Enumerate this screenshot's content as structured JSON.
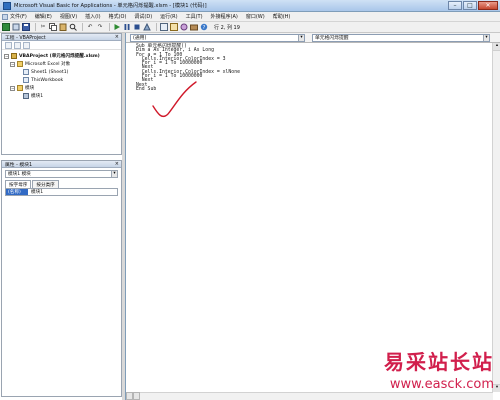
{
  "window": {
    "title": "Microsoft Visual Basic for Applications - 单元格闪烁提醒.xlsm - [模块1 (代码)]",
    "minimize": "–",
    "maximize": "□",
    "close": "✕"
  },
  "menus": [
    "文件(F)",
    "编辑(E)",
    "视图(V)",
    "插入(I)",
    "格式(O)",
    "调试(D)",
    "运行(R)",
    "工具(T)",
    "外接程序(A)",
    "窗口(W)",
    "帮助(H)"
  ],
  "toolbar": {
    "position": "行 2, 列 19"
  },
  "project": {
    "title": "工程 - VBAProject",
    "close": "×",
    "root": "VBAProject (单元格闪烁提醒.xlsm)",
    "excel_objects": "Microsoft Excel 对象",
    "sheet1": "Sheet1 (Sheet1)",
    "thisworkbook": "ThisWorkbook",
    "modules_folder": "模块",
    "module1": "模块1"
  },
  "properties": {
    "title": "属性 - 模块1",
    "close": "×",
    "selector": "模块1 模块",
    "tab_alpha": "按字母序",
    "tab_category": "按分类序",
    "prop_name": "(名称)",
    "prop_value": "模块1"
  },
  "code": {
    "object_combo": "(通用)",
    "proc_combo": "单元格闪烁提醒",
    "lines": [
      "Sub 单元格闪烁提醒()",
      "Dim a As Integer, i As Long",
      "For a = 1 To 100",
      "  Cells.Interior.ColorIndex = 3",
      "  For i = 1 To 10000000",
      "  Next",
      "  Cells.Interior.ColorIndex = xlNone",
      "  For i = 1 To 10000000",
      "  Next",
      "Next",
      "End Sub"
    ]
  },
  "annotation": {
    "color": "#d0192a"
  },
  "watermark": {
    "cn": "易采站长站",
    "url": "www.easck.com",
    "color": "#d11f4c"
  }
}
